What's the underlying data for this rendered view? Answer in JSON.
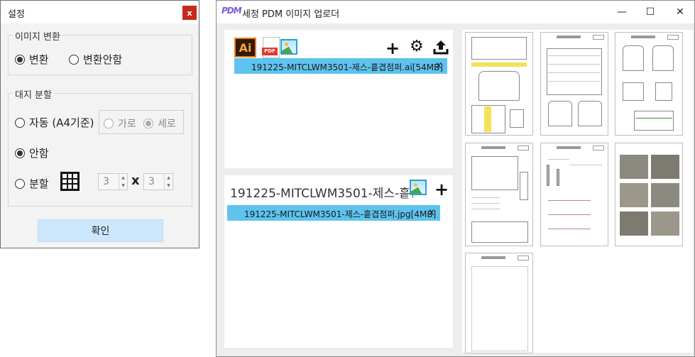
{
  "settings": {
    "title": "설정",
    "close_label": "x",
    "image_convert": {
      "label": "이미지 변환",
      "options": [
        "변환",
        "변환안함"
      ],
      "selected": "변환"
    },
    "split": {
      "label": "대지 분할",
      "auto_label": "자동 (A4기준)",
      "orientation_options": [
        "가로",
        "세로"
      ],
      "orientation_selected": "세로",
      "none_label": "안함",
      "split_label": "분할",
      "selected": "안함",
      "cols": "3",
      "rows_label": "x",
      "rows": "3"
    },
    "confirm_label": "확인"
  },
  "main": {
    "logo_text": "PDM",
    "title": "세정 PDM 이미지 업로더",
    "window_controls": [
      "—",
      "☐",
      "✕"
    ],
    "ai_icon_text": "Ai",
    "pdf_icon_text": "PDF",
    "ai_panel": {
      "file_name": "191225-MITCLWM3501-제스-흩겹점퍼.ai[54MB]",
      "remove_label": "x"
    },
    "jpg_panel": {
      "name_field": "191225-MITCLWM3501-제스-흩겹점퍼",
      "file_name": "191225-MITCLWM3501-제스-흩겹점퍼.jpg[4MB]",
      "remove_label": "x"
    }
  }
}
